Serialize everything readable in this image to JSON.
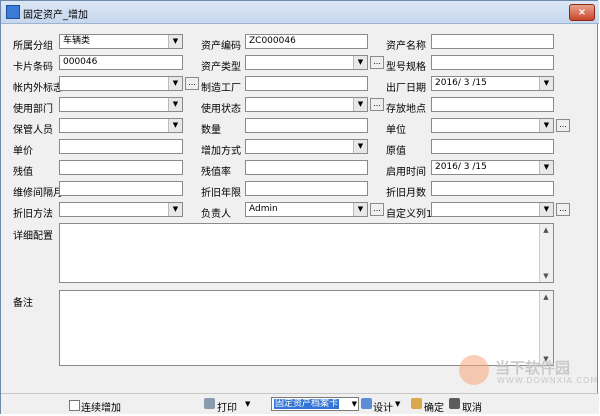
{
  "window": {
    "title": "固定资产_增加",
    "close_label": "×"
  },
  "form": {
    "category": {
      "label": "所属分组",
      "value": "车辆类"
    },
    "asset_code": {
      "label": "资产编码",
      "value": "ZC000046"
    },
    "asset_name": {
      "label": "资产名称",
      "value": ""
    },
    "card_barcode": {
      "label": "卡片条码",
      "value": "000046"
    },
    "asset_type": {
      "label": "资产类型",
      "value": ""
    },
    "model_spec": {
      "label": "型号规格",
      "value": ""
    },
    "account_mark": {
      "label": "帐内外标志",
      "value": ""
    },
    "manufacturer": {
      "label": "制造工厂",
      "value": ""
    },
    "production_date": {
      "label": "出厂日期",
      "value": "2016/ 3 /15"
    },
    "dept": {
      "label": "使用部门",
      "value": ""
    },
    "use_status": {
      "label": "使用状态",
      "value": ""
    },
    "location": {
      "label": "存放地点",
      "value": ""
    },
    "keeper": {
      "label": "保管人员",
      "value": ""
    },
    "quantity": {
      "label": "数量",
      "value": ""
    },
    "unit": {
      "label": "单位",
      "value": ""
    },
    "unit_price": {
      "label": "单价",
      "value": ""
    },
    "add_method": {
      "label": "增加方式",
      "value": ""
    },
    "original_value": {
      "label": "原值",
      "value": ""
    },
    "residual": {
      "label": "残值",
      "value": ""
    },
    "residual_rate": {
      "label": "残值率",
      "value": ""
    },
    "start_date": {
      "label": "启用时间",
      "value": "2016/ 3 /15"
    },
    "maintenance_interval": {
      "label": "维修间隔月",
      "value": ""
    },
    "depreciation_years": {
      "label": "折旧年限",
      "value": ""
    },
    "depreciation_months": {
      "label": "折旧月数",
      "value": ""
    },
    "depreciation_method": {
      "label": "折旧方法",
      "value": ""
    },
    "responsible": {
      "label": "负责人",
      "value": "Admin"
    },
    "custom1": {
      "label": "自定义列1",
      "value": ""
    },
    "detail_config": {
      "label": "详细配置",
      "value": ""
    },
    "remarks": {
      "label": "备注",
      "value": ""
    }
  },
  "statusbar": {
    "continuous_add": "连续增加",
    "print": "打印",
    "template": "固定资产档案卡",
    "design": "设计",
    "confirm": "确定",
    "cancel": "取消"
  },
  "watermark": {
    "title": "当下软件园",
    "subtitle": "WWW.DOWNXIA.COM"
  }
}
